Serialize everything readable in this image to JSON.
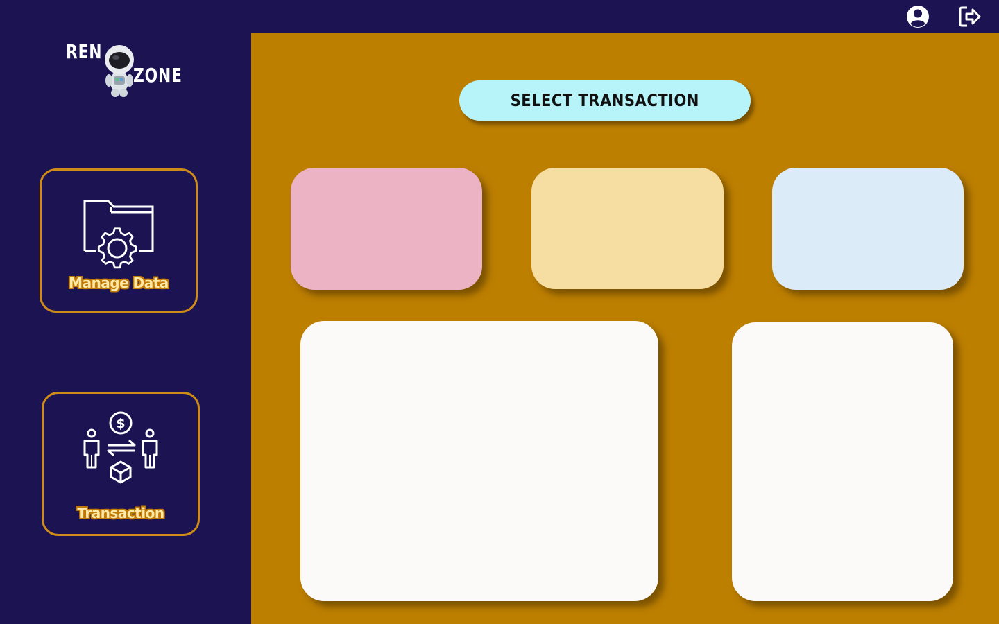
{
  "app": {
    "logo": {
      "word1": "REN",
      "word2": "ZONE",
      "mascot_icon": "astronaut-icon"
    }
  },
  "topbar": {
    "profile_icon": "user-circle-icon",
    "logout_icon": "sign-out-icon"
  },
  "sidebar": {
    "items": [
      {
        "label": "Manage Data",
        "icon": "folder-gear-icon"
      },
      {
        "label": "Transaction",
        "icon": "exchange-icon"
      }
    ]
  },
  "main": {
    "select_button_label": "SELECT TRANSACTION",
    "cards": [
      {
        "name": "card-pink",
        "color": "#ecb3c5"
      },
      {
        "name": "card-yellow",
        "color": "#f6dea2"
      },
      {
        "name": "card-blue",
        "color": "#dcebf8"
      }
    ],
    "panels": [
      {
        "name": "panel-large",
        "color": "#fcf9f9"
      },
      {
        "name": "panel-side",
        "color": "#fcf9f9"
      }
    ]
  },
  "colors": {
    "sidebar_bg": "#1c1452",
    "main_bg": "#bd7f00",
    "accent_border": "#cf8b17",
    "select_button_bg": "#b6f4fa"
  }
}
